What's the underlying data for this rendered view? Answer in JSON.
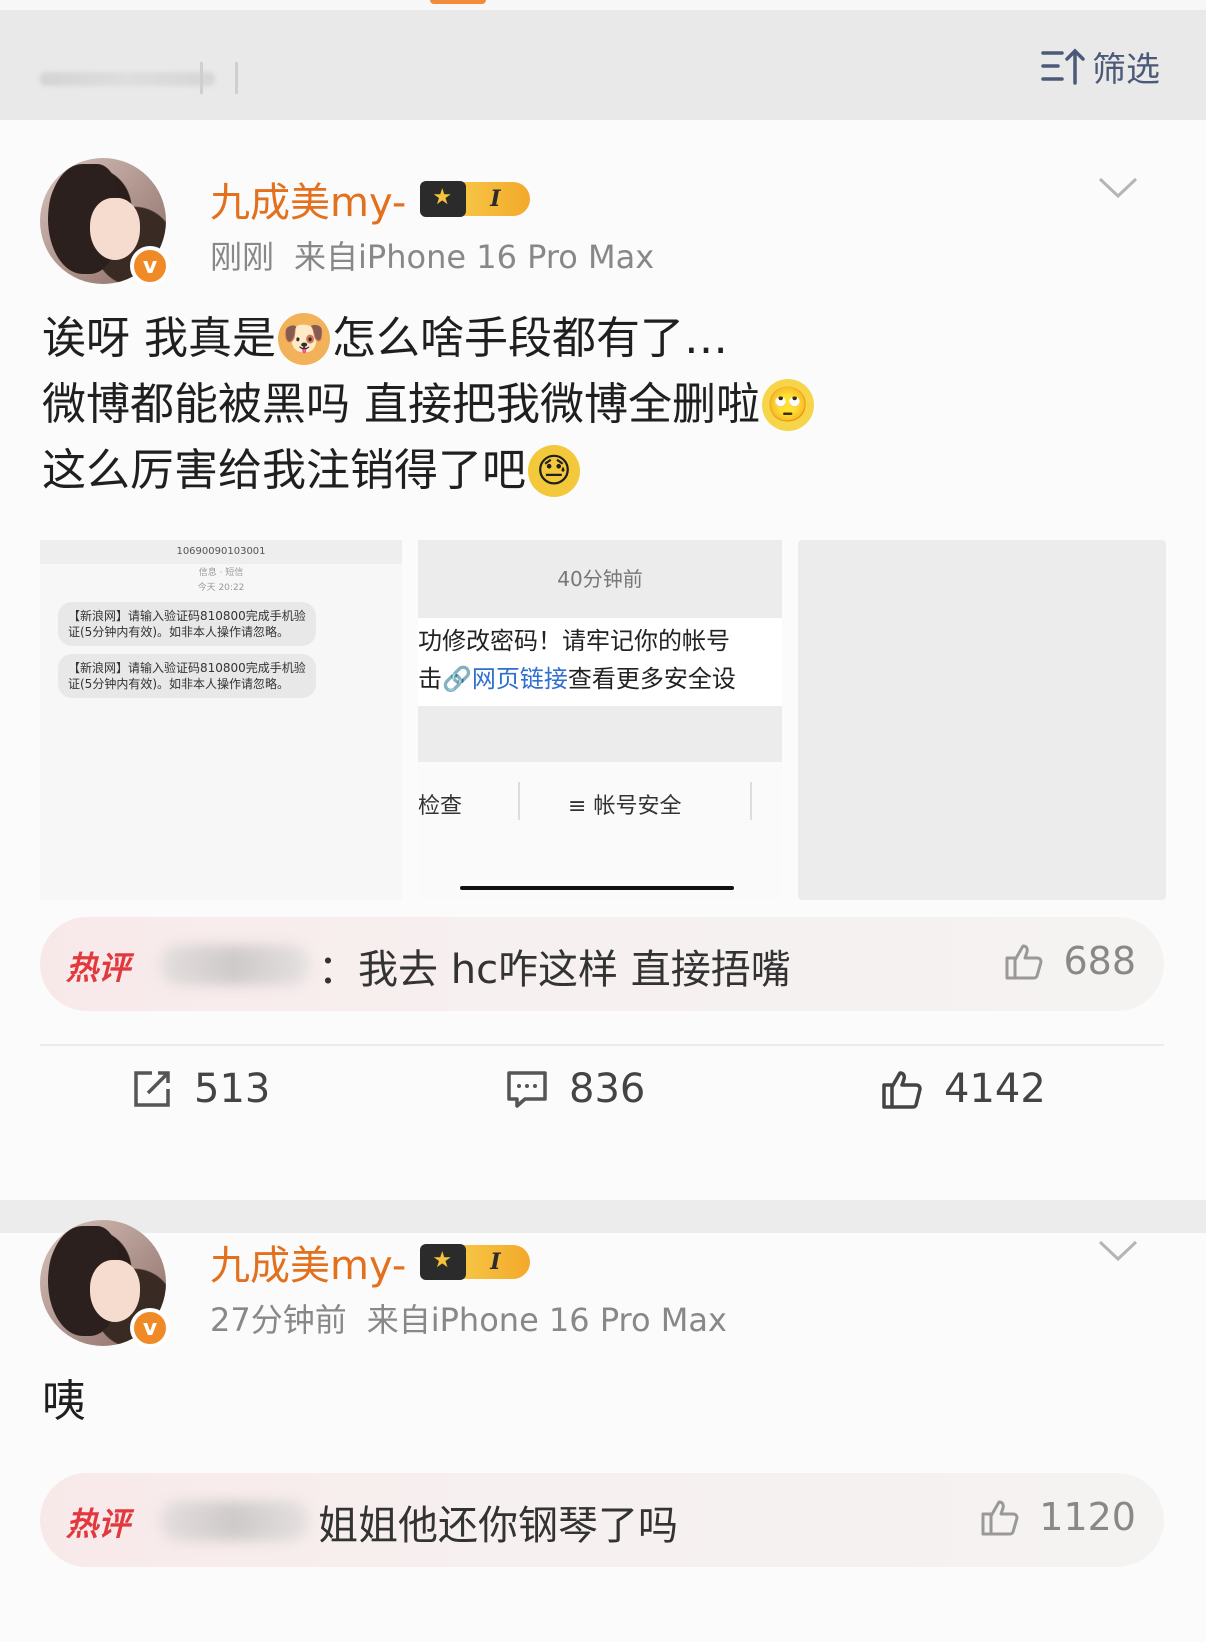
{
  "filter_bar": {
    "filter_label": "筛选"
  },
  "posts": [
    {
      "username": "九成美my-",
      "vip_level": "I",
      "verified_badge": "v",
      "time": "刚刚",
      "source": "来自iPhone 16 Pro Max",
      "content": {
        "line1_a": "诶呀 我真是",
        "line1_b": "怎么啥手段都有了…",
        "line2": "微博都能被黑吗 直接把我微博全删啦",
        "line3": "这么厉害给我注销得了吧"
      },
      "emojis": [
        "dog-emoji",
        "eye-roll-emoji",
        "sweat-emoji"
      ],
      "images": {
        "sms_sender": "10690090103001",
        "sms_sub1": "信息 · 短信",
        "sms_sub2": "今天 20:22",
        "sms_messages": [
          "【新浪网】请输入验证码810800完成手机验证(5分钟内有效)。如非本人操作请忽略。",
          "【新浪网】请输入验证码810800完成手机验证(5分钟内有效)。如非本人操作请忽略。"
        ],
        "notice_time": "40分钟前",
        "notice_line1": "功修改密码！请牢记你的帐号",
        "notice_line2_pre": "击",
        "notice_link": "🔗网页链接",
        "notice_line2_post": "查看更多安全设",
        "tab_left": "检查",
        "tab_right": "帐号安全"
      },
      "hot_comment": {
        "tag": "热评",
        "text": "：我去 hc咋这样 直接捂嘴",
        "likes": "688"
      },
      "stats": {
        "reposts": "513",
        "comments": "836",
        "likes": "4142"
      }
    },
    {
      "username": "九成美my-",
      "vip_level": "I",
      "verified_badge": "v",
      "time": "27分钟前",
      "source": "来自iPhone 16 Pro Max",
      "content": {
        "line1": "咦"
      },
      "hot_comment": {
        "tag": "热评",
        "text": "姐姐他还你钢琴了吗",
        "likes": "1120"
      }
    }
  ],
  "colors": {
    "username": "#e3701c",
    "hot_tag": "#e2393e",
    "link": "#2f6fd0",
    "badge": "#f08a26"
  }
}
